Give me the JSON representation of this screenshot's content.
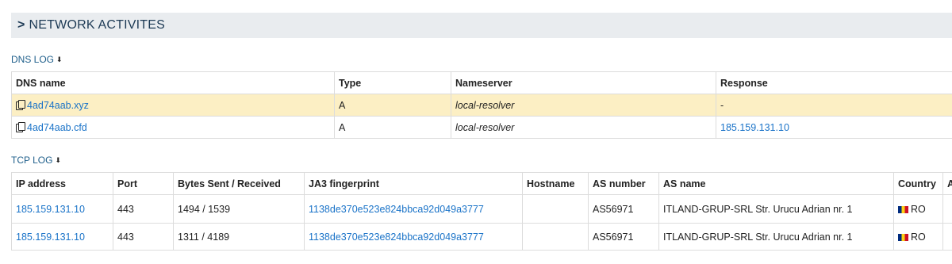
{
  "section": {
    "chevron": ">",
    "title": "NETWORK ACTIVITES"
  },
  "dns": {
    "title": "DNS LOG",
    "download_glyph": "⬇",
    "columns": [
      "DNS name",
      "Type",
      "Nameserver",
      "Response"
    ],
    "rows": [
      {
        "name": "4ad74aab.xyz",
        "type": "A",
        "nameserver": "local-resolver",
        "response": "-",
        "highlighted": true
      },
      {
        "name": "4ad74aab.cfd",
        "type": "A",
        "nameserver": "local-resolver",
        "response": "185.159.131.10",
        "highlighted": false
      }
    ]
  },
  "tcp": {
    "title": "TCP LOG",
    "download_glyph": "⬇",
    "columns": [
      "IP address",
      "Port",
      "Bytes Sent / Received",
      "JA3 fingerprint",
      "Hostname",
      "AS number",
      "AS name",
      "Country",
      "A"
    ],
    "rows": [
      {
        "ip": "185.159.131.10",
        "port": "443",
        "bytes": "1494 / 1539",
        "ja3": "1138de370e523e824bbca92d049a3777",
        "hostname": "",
        "as_number": "AS56971",
        "as_name": "ITLAND-GRUP-SRL Str. Urucu Adrian nr. 1",
        "country": "RO"
      },
      {
        "ip": "185.159.131.10",
        "port": "443",
        "bytes": "1311 / 4189",
        "ja3": "1138de370e523e824bbca92d049a3777",
        "hostname": "",
        "as_number": "AS56971",
        "as_name": "ITLAND-GRUP-SRL Str. Urucu Adrian nr. 1",
        "country": "RO"
      }
    ]
  },
  "colors": {
    "link": "#1a73c8",
    "highlight_row": "#fcefc4",
    "section_bg": "#e9ecef"
  },
  "icons": {
    "copy": "copy-icon",
    "download": "download-icon",
    "flag": "romania-flag-icon"
  }
}
